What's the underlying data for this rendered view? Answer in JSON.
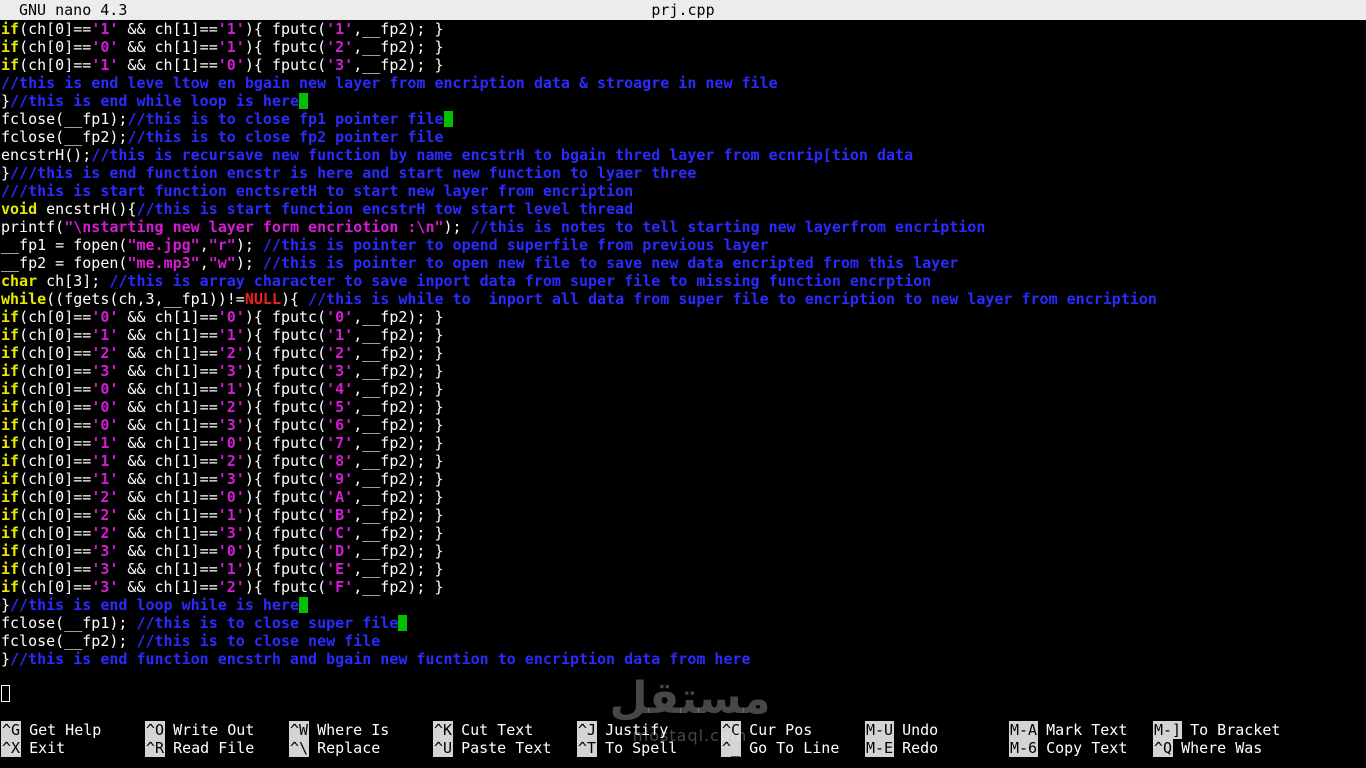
{
  "titlebar": {
    "app": "GNU nano 4.3",
    "filename": "prj.cpp"
  },
  "editor": {
    "lines": [
      [
        [
          "kw",
          "if"
        ],
        [
          "p",
          "(ch[0]=="
        ],
        [
          "str",
          "'1'"
        ],
        [
          "p",
          " && ch[1]=="
        ],
        [
          "str",
          "'1'"
        ],
        [
          "p",
          "){ fputc("
        ],
        [
          "str",
          "'1'"
        ],
        [
          "p",
          ",__fp2); }"
        ]
      ],
      [
        [
          "kw",
          "if"
        ],
        [
          "p",
          "(ch[0]=="
        ],
        [
          "str",
          "'0'"
        ],
        [
          "p",
          " && ch[1]=="
        ],
        [
          "str",
          "'1'"
        ],
        [
          "p",
          "){ fputc("
        ],
        [
          "str",
          "'2'"
        ],
        [
          "p",
          ",__fp2); }"
        ]
      ],
      [
        [
          "kw",
          "if"
        ],
        [
          "p",
          "(ch[0]=="
        ],
        [
          "str",
          "'1'"
        ],
        [
          "p",
          " && ch[1]=="
        ],
        [
          "str",
          "'0'"
        ],
        [
          "p",
          "){ fputc("
        ],
        [
          "str",
          "'3'"
        ],
        [
          "p",
          ",__fp2); }"
        ]
      ],
      [
        [
          "cmt",
          "//this is end leve ltow en bgain new layer from encription data & stroagre in new file"
        ]
      ],
      [
        [
          "p",
          "}"
        ],
        [
          "cmt",
          "//this is end while loop is here"
        ],
        [
          "cur",
          ""
        ]
      ],
      [
        [
          "p",
          "fclose(__fp1);"
        ],
        [
          "cmt",
          "//this is to close fp1 pointer file"
        ],
        [
          "cur",
          ""
        ]
      ],
      [
        [
          "p",
          "fclose(__fp2);"
        ],
        [
          "cmt",
          "//this is to close fp2 pointer file"
        ]
      ],
      [
        [
          "p",
          "encstrH();"
        ],
        [
          "cmt",
          "//this is recursave new function by name encstrH to bgain thred layer from ecnrip[tion data"
        ]
      ],
      [
        [
          "p",
          "}"
        ],
        [
          "cmt",
          "///this is end function encstr is here and start new function to lyaer three"
        ]
      ],
      [
        [
          "cmt",
          "///this is start function enctsretH to start new layer from encription"
        ]
      ],
      [
        [
          "kw",
          "void"
        ],
        [
          "p",
          " encstrH(){"
        ],
        [
          "cmt",
          "//this is start function encstrH tow start level thread"
        ]
      ],
      [
        [
          "p",
          "printf("
        ],
        [
          "str",
          "\"\\nstarting new layer form encriotion :\\n\""
        ],
        [
          "p",
          "); "
        ],
        [
          "cmt",
          "//this is notes to tell starting new layerfrom encription"
        ]
      ],
      [
        [
          "p",
          "__fp1 = fopen("
        ],
        [
          "str",
          "\"me.jpg\""
        ],
        [
          "p",
          ","
        ],
        [
          "str",
          "\"r\""
        ],
        [
          "p",
          "); "
        ],
        [
          "cmt",
          "//this is pointer to opend superfile from previous layer"
        ]
      ],
      [
        [
          "p",
          "__fp2 = fopen("
        ],
        [
          "str",
          "\"me.mp3\""
        ],
        [
          "p",
          ","
        ],
        [
          "str",
          "\"w\""
        ],
        [
          "p",
          "); "
        ],
        [
          "cmt",
          "//this is pointer to open new file to save new data encripted from this layer"
        ]
      ],
      [
        [
          "kw",
          "char"
        ],
        [
          "p",
          " ch[3]; "
        ],
        [
          "cmt",
          "//this is array character to save inport data from super file to missing function encrption"
        ]
      ],
      [
        [
          "kw",
          "while"
        ],
        [
          "p",
          "((fgets(ch,3,__fp1))!="
        ],
        [
          "nl",
          "NULL"
        ],
        [
          "p",
          "){ "
        ],
        [
          "cmt",
          "//this is while to  inport all data from super file to encription to new layer from encription"
        ]
      ],
      [
        [
          "kw",
          "if"
        ],
        [
          "p",
          "(ch[0]=="
        ],
        [
          "str",
          "'0'"
        ],
        [
          "p",
          " && ch[1]=="
        ],
        [
          "str",
          "'0'"
        ],
        [
          "p",
          "){ fputc("
        ],
        [
          "str",
          "'0'"
        ],
        [
          "p",
          ",__fp2); }"
        ]
      ],
      [
        [
          "kw",
          "if"
        ],
        [
          "p",
          "(ch[0]=="
        ],
        [
          "str",
          "'1'"
        ],
        [
          "p",
          " && ch[1]=="
        ],
        [
          "str",
          "'1'"
        ],
        [
          "p",
          "){ fputc("
        ],
        [
          "str",
          "'1'"
        ],
        [
          "p",
          ",__fp2); }"
        ]
      ],
      [
        [
          "kw",
          "if"
        ],
        [
          "p",
          "(ch[0]=="
        ],
        [
          "str",
          "'2'"
        ],
        [
          "p",
          " && ch[1]=="
        ],
        [
          "str",
          "'2'"
        ],
        [
          "p",
          "){ fputc("
        ],
        [
          "str",
          "'2'"
        ],
        [
          "p",
          ",__fp2); }"
        ]
      ],
      [
        [
          "kw",
          "if"
        ],
        [
          "p",
          "(ch[0]=="
        ],
        [
          "str",
          "'3'"
        ],
        [
          "p",
          " && ch[1]=="
        ],
        [
          "str",
          "'3'"
        ],
        [
          "p",
          "){ fputc("
        ],
        [
          "str",
          "'3'"
        ],
        [
          "p",
          ",__fp2); }"
        ]
      ],
      [
        [
          "kw",
          "if"
        ],
        [
          "p",
          "(ch[0]=="
        ],
        [
          "str",
          "'0'"
        ],
        [
          "p",
          " && ch[1]=="
        ],
        [
          "str",
          "'1'"
        ],
        [
          "p",
          "){ fputc("
        ],
        [
          "str",
          "'4'"
        ],
        [
          "p",
          ",__fp2); }"
        ]
      ],
      [
        [
          "kw",
          "if"
        ],
        [
          "p",
          "(ch[0]=="
        ],
        [
          "str",
          "'0'"
        ],
        [
          "p",
          " && ch[1]=="
        ],
        [
          "str",
          "'2'"
        ],
        [
          "p",
          "){ fputc("
        ],
        [
          "str",
          "'5'"
        ],
        [
          "p",
          ",__fp2); }"
        ]
      ],
      [
        [
          "kw",
          "if"
        ],
        [
          "p",
          "(ch[0]=="
        ],
        [
          "str",
          "'0'"
        ],
        [
          "p",
          " && ch[1]=="
        ],
        [
          "str",
          "'3'"
        ],
        [
          "p",
          "){ fputc("
        ],
        [
          "str",
          "'6'"
        ],
        [
          "p",
          ",__fp2); }"
        ]
      ],
      [
        [
          "kw",
          "if"
        ],
        [
          "p",
          "(ch[0]=="
        ],
        [
          "str",
          "'1'"
        ],
        [
          "p",
          " && ch[1]=="
        ],
        [
          "str",
          "'0'"
        ],
        [
          "p",
          "){ fputc("
        ],
        [
          "str",
          "'7'"
        ],
        [
          "p",
          ",__fp2); }"
        ]
      ],
      [
        [
          "kw",
          "if"
        ],
        [
          "p",
          "(ch[0]=="
        ],
        [
          "str",
          "'1'"
        ],
        [
          "p",
          " && ch[1]=="
        ],
        [
          "str",
          "'2'"
        ],
        [
          "p",
          "){ fputc("
        ],
        [
          "str",
          "'8'"
        ],
        [
          "p",
          ",__fp2); }"
        ]
      ],
      [
        [
          "kw",
          "if"
        ],
        [
          "p",
          "(ch[0]=="
        ],
        [
          "str",
          "'1'"
        ],
        [
          "p",
          " && ch[1]=="
        ],
        [
          "str",
          "'3'"
        ],
        [
          "p",
          "){ fputc("
        ],
        [
          "str",
          "'9'"
        ],
        [
          "p",
          ",__fp2); }"
        ]
      ],
      [
        [
          "kw",
          "if"
        ],
        [
          "p",
          "(ch[0]=="
        ],
        [
          "str",
          "'2'"
        ],
        [
          "p",
          " && ch[1]=="
        ],
        [
          "str",
          "'0'"
        ],
        [
          "p",
          "){ fputc("
        ],
        [
          "str",
          "'A'"
        ],
        [
          "p",
          ",__fp2); }"
        ]
      ],
      [
        [
          "kw",
          "if"
        ],
        [
          "p",
          "(ch[0]=="
        ],
        [
          "str",
          "'2'"
        ],
        [
          "p",
          " && ch[1]=="
        ],
        [
          "str",
          "'1'"
        ],
        [
          "p",
          "){ fputc("
        ],
        [
          "str",
          "'B'"
        ],
        [
          "p",
          ",__fp2); }"
        ]
      ],
      [
        [
          "kw",
          "if"
        ],
        [
          "p",
          "(ch[0]=="
        ],
        [
          "str",
          "'2'"
        ],
        [
          "p",
          " && ch[1]=="
        ],
        [
          "str",
          "'3'"
        ],
        [
          "p",
          "){ fputc("
        ],
        [
          "str",
          "'C'"
        ],
        [
          "p",
          ",__fp2); }"
        ]
      ],
      [
        [
          "kw",
          "if"
        ],
        [
          "p",
          "(ch[0]=="
        ],
        [
          "str",
          "'3'"
        ],
        [
          "p",
          " && ch[1]=="
        ],
        [
          "str",
          "'0'"
        ],
        [
          "p",
          "){ fputc("
        ],
        [
          "str",
          "'D'"
        ],
        [
          "p",
          ",__fp2); }"
        ]
      ],
      [
        [
          "kw",
          "if"
        ],
        [
          "p",
          "(ch[0]=="
        ],
        [
          "str",
          "'3'"
        ],
        [
          "p",
          " && ch[1]=="
        ],
        [
          "str",
          "'1'"
        ],
        [
          "p",
          "){ fputc("
        ],
        [
          "str",
          "'E'"
        ],
        [
          "p",
          ",__fp2); }"
        ]
      ],
      [
        [
          "kw",
          "if"
        ],
        [
          "p",
          "(ch[0]=="
        ],
        [
          "str",
          "'3'"
        ],
        [
          "p",
          " && ch[1]=="
        ],
        [
          "str",
          "'2'"
        ],
        [
          "p",
          "){ fputc("
        ],
        [
          "str",
          "'F'"
        ],
        [
          "p",
          ",__fp2); }"
        ]
      ],
      [
        [
          "p",
          "}"
        ],
        [
          "cmt",
          "//this is end loop while is here"
        ],
        [
          "cur",
          ""
        ]
      ],
      [
        [
          "p",
          "fclose(__fp1); "
        ],
        [
          "cmt",
          "//this is to close super file"
        ],
        [
          "cur",
          ""
        ]
      ],
      [
        [
          "p",
          "fclose(__fp2); "
        ],
        [
          "cmt",
          "//this is to close new file"
        ]
      ],
      [
        [
          "p",
          "}"
        ],
        [
          "cmt",
          "//this is end function encstrh and bgain new fucntion to encription data from here"
        ]
      ]
    ]
  },
  "shortcuts": [
    {
      "key": "^G",
      "label": "Get Help"
    },
    {
      "key": "^X",
      "label": "Exit"
    },
    {
      "key": "^O",
      "label": "Write Out"
    },
    {
      "key": "^R",
      "label": "Read File"
    },
    {
      "key": "^W",
      "label": "Where Is"
    },
    {
      "key": "^\\",
      "label": "Replace"
    },
    {
      "key": "^K",
      "label": "Cut Text"
    },
    {
      "key": "^U",
      "label": "Paste Text"
    },
    {
      "key": "^J",
      "label": "Justify"
    },
    {
      "key": "^T",
      "label": "To Spell"
    },
    {
      "key": "^C",
      "label": "Cur Pos"
    },
    {
      "key": "^_",
      "label": "Go To Line"
    },
    {
      "key": "M-U",
      "label": "Undo"
    },
    {
      "key": "M-E",
      "label": "Redo"
    },
    {
      "key": "M-A",
      "label": "Mark Text"
    },
    {
      "key": "M-6",
      "label": "Copy Text"
    },
    {
      "key": "M-]",
      "label": "To Bracket"
    },
    {
      "key": "^Q",
      "label": "Where Was"
    }
  ],
  "watermark": {
    "arabic": "مستقل",
    "latin": "mostaql.com"
  }
}
